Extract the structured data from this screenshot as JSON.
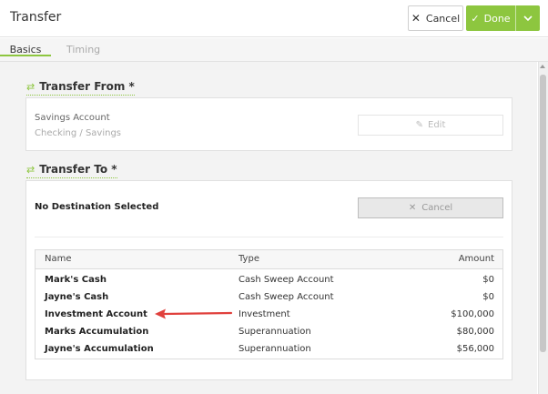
{
  "header": {
    "title": "Transfer",
    "cancel_label": "Cancel",
    "done_label": "Done"
  },
  "tabs": [
    {
      "label": "Basics",
      "active": true
    },
    {
      "label": "Timing",
      "active": false
    }
  ],
  "transfer_from": {
    "title": "Transfer From *",
    "account_name": "Savings Account",
    "account_type": "Checking / Savings",
    "edit_label": "Edit"
  },
  "transfer_to": {
    "title": "Transfer To *",
    "status": "No Destination Selected",
    "cancel_label": "Cancel"
  },
  "table": {
    "headers": [
      "Name",
      "Type",
      "Amount"
    ],
    "rows": [
      {
        "name": "Mark's Cash",
        "type": "Cash Sweep Account",
        "amount": "$0"
      },
      {
        "name": "Jayne's Cash",
        "type": "Cash Sweep Account",
        "amount": "$0"
      },
      {
        "name": "Investment Account",
        "type": "Investment",
        "amount": "$100,000"
      },
      {
        "name": "Marks Accumulation",
        "type": "Superannuation",
        "amount": "$80,000"
      },
      {
        "name": "Jayne's Accumulation",
        "type": "Superannuation",
        "amount": "$56,000"
      }
    ]
  },
  "colors": {
    "accent": "#8dc63f",
    "annotation_arrow": "#e0403c"
  },
  "icons": [
    "close-icon",
    "check-icon",
    "chevron-down-icon",
    "transfer-icon",
    "pencil-icon",
    "arrow-annotation"
  ]
}
